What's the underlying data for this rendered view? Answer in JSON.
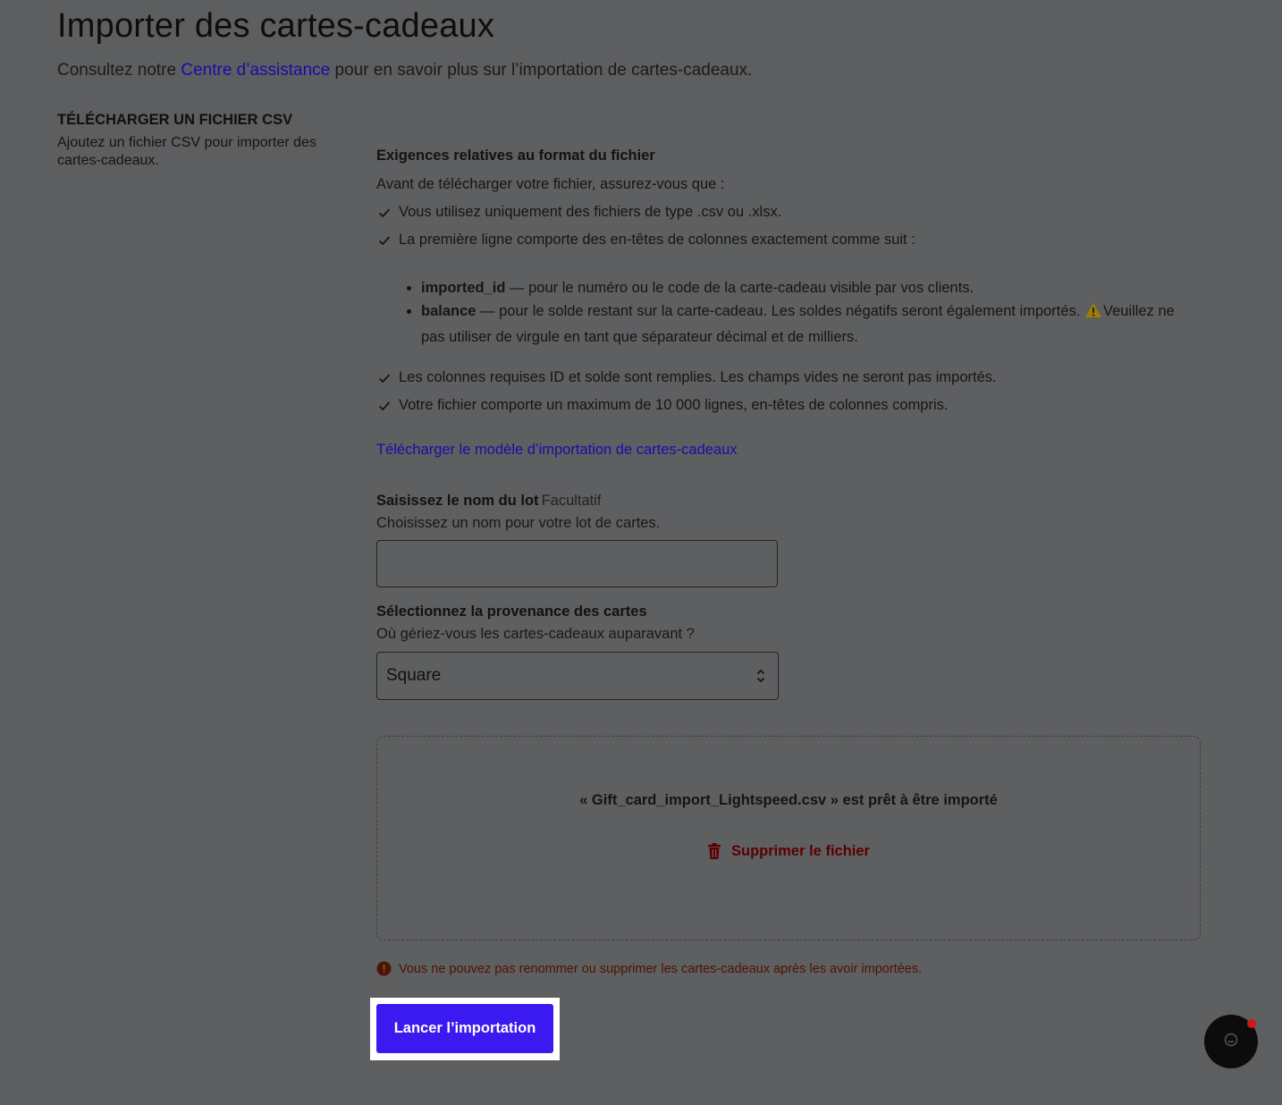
{
  "header": {
    "title": "Importer des cartes-cadeaux",
    "subtitle_before": "Consultez notre ",
    "subtitle_link": "Centre d’assistance",
    "subtitle_after": " pour en savoir plus sur l’importation de cartes-cadeaux."
  },
  "section": {
    "title": "TÉLÉCHARGER UN FICHIER CSV",
    "description": "Ajoutez un fichier CSV pour importer des cartes-cadeaux."
  },
  "requirements": {
    "title": "Exigences relatives au format du fichier",
    "intro": "Avant de télécharger votre fichier, assurez-vous que :",
    "checks_top": [
      "Vous utilisez uniquement des fichiers de type .csv ou .xlsx.",
      "La première ligne comporte des en-têtes de colonnes exactement comme suit :"
    ],
    "columns": [
      {
        "name": "imported_id",
        "text": " — pour le numéro ou le code de la carte-cadeau visible par vos clients."
      },
      {
        "name": "balance",
        "text": " — pour le solde restant sur la carte-cadeau. Les soldes négatifs seront également importés. ",
        "warning": "Veuillez ne pas utiliser de virgule en tant que séparateur décimal et de milliers."
      }
    ],
    "checks_bottom": [
      "Les colonnes requises ID et solde sont remplies. Les champs vides ne seront pas importés.",
      "Votre fichier comporte un maximum de 10 000 lignes, en-têtes de colonnes compris."
    ],
    "template_link": "Télécharger le modèle d’importation de cartes-cadeaux"
  },
  "batch_name": {
    "label": "Saisissez le nom du lot",
    "optional": "Facultatif",
    "help": "Choisissez un nom pour votre lot de cartes.",
    "value": ""
  },
  "source": {
    "label": "Sélectionnez la provenance des cartes",
    "help": "Où gériez-vous les cartes-cadeaux auparavant ?",
    "selected": "Square"
  },
  "upload": {
    "ready_message": "« Gift_card_import_Lightspeed.csv » est prêt à être importé",
    "delete_label": "Supprimer le fichier"
  },
  "notice": "Vous ne pouvez pas renommer ou supprimer les cartes-cadeaux après les avoir importées.",
  "actions": {
    "start_import": "Lancer l’importation"
  },
  "colors": {
    "overlay_background": "#5d5e60",
    "link": "#1e0aa8",
    "primary_button": "#3a1af0",
    "danger": "#5a0000",
    "notice": "#4f1300",
    "chat_badge": "#d01818"
  },
  "icons": [
    "check-icon",
    "warning-icon",
    "trash-icon",
    "info-icon",
    "chevron-updown-icon",
    "chat-icon"
  ]
}
